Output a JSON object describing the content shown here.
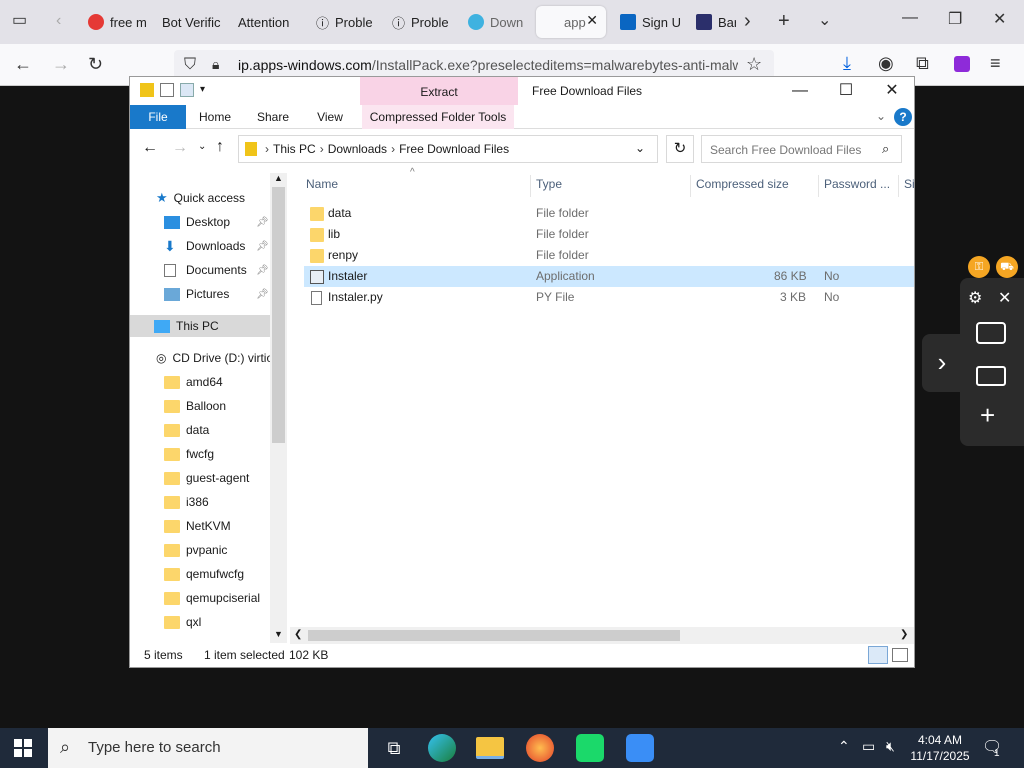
{
  "browser": {
    "tabs": [
      {
        "label": "free m",
        "icon": "yandex-icon",
        "color": "#e53935"
      },
      {
        "label": "Bot Verific",
        "icon": "",
        "color": ""
      },
      {
        "label": "Attention",
        "icon": "",
        "color": ""
      },
      {
        "label": "Proble",
        "icon": "info-icon",
        "color": ""
      },
      {
        "label": "Proble",
        "icon": "info-icon",
        "color": ""
      },
      {
        "label": "Down",
        "icon": "download-site-icon",
        "color": "#3fb2e0"
      },
      {
        "label": "app",
        "icon": "",
        "color": ""
      },
      {
        "label": "Sign U",
        "icon": "linkedin-icon",
        "color": "#0a66c2"
      },
      {
        "label": "Bar",
        "icon": "bar-icon",
        "color": "#2b2f6b"
      }
    ],
    "url_host": "ip.apps-windows.com",
    "url_path": "/InstallPack.exe?preselecteditems=malwarebytes-anti-malwa"
  },
  "explorer": {
    "extract_label": "Extract",
    "title": "Free Download Files",
    "ribbon_tabs": {
      "file": "File",
      "home": "Home",
      "share": "Share",
      "view": "View",
      "compressed_tools": "Compressed Folder Tools"
    },
    "breadcrumb": [
      "This PC",
      "Downloads",
      "Free Download Files"
    ],
    "search_placeholder": "Search Free Download Files",
    "nav": {
      "quick_access": "Quick access",
      "pinned": [
        "Desktop",
        "Downloads",
        "Documents",
        "Pictures"
      ],
      "this_pc": "This PC",
      "cd_drive": "CD Drive (D:) virtio",
      "folders": [
        "amd64",
        "Balloon",
        "data",
        "fwcfg",
        "guest-agent",
        "i386",
        "NetKVM",
        "pvpanic",
        "qemufwcfg",
        "qemupciserial",
        "qxl"
      ]
    },
    "columns": {
      "name": "Name",
      "type": "Type",
      "compressed_size": "Compressed size",
      "password": "Password ...",
      "size": "Si"
    },
    "files": [
      {
        "name": "data",
        "type": "File folder",
        "csize": "",
        "password": "",
        "kind": "folder"
      },
      {
        "name": "lib",
        "type": "File folder",
        "csize": "",
        "password": "",
        "kind": "folder"
      },
      {
        "name": "renpy",
        "type": "File folder",
        "csize": "",
        "password": "",
        "kind": "folder"
      },
      {
        "name": "Instaler",
        "type": "Application",
        "csize": "86 KB",
        "password": "No",
        "kind": "app"
      },
      {
        "name": "Instaler.py",
        "type": "PY File",
        "csize": "3 KB",
        "password": "No",
        "kind": "file"
      }
    ],
    "status": {
      "items": "5 items",
      "selected": "1 item selected",
      "size": "102 KB"
    }
  },
  "taskbar": {
    "search_placeholder": "Type here to search",
    "time": "4:04 AM",
    "date": "11/17/2025",
    "notification_count": "1"
  },
  "colors": {
    "ribbon_file": "#1979ca",
    "selection": "#cce8ff",
    "folder": "#fcd66b",
    "extract_tab": "#f9d3e6"
  }
}
